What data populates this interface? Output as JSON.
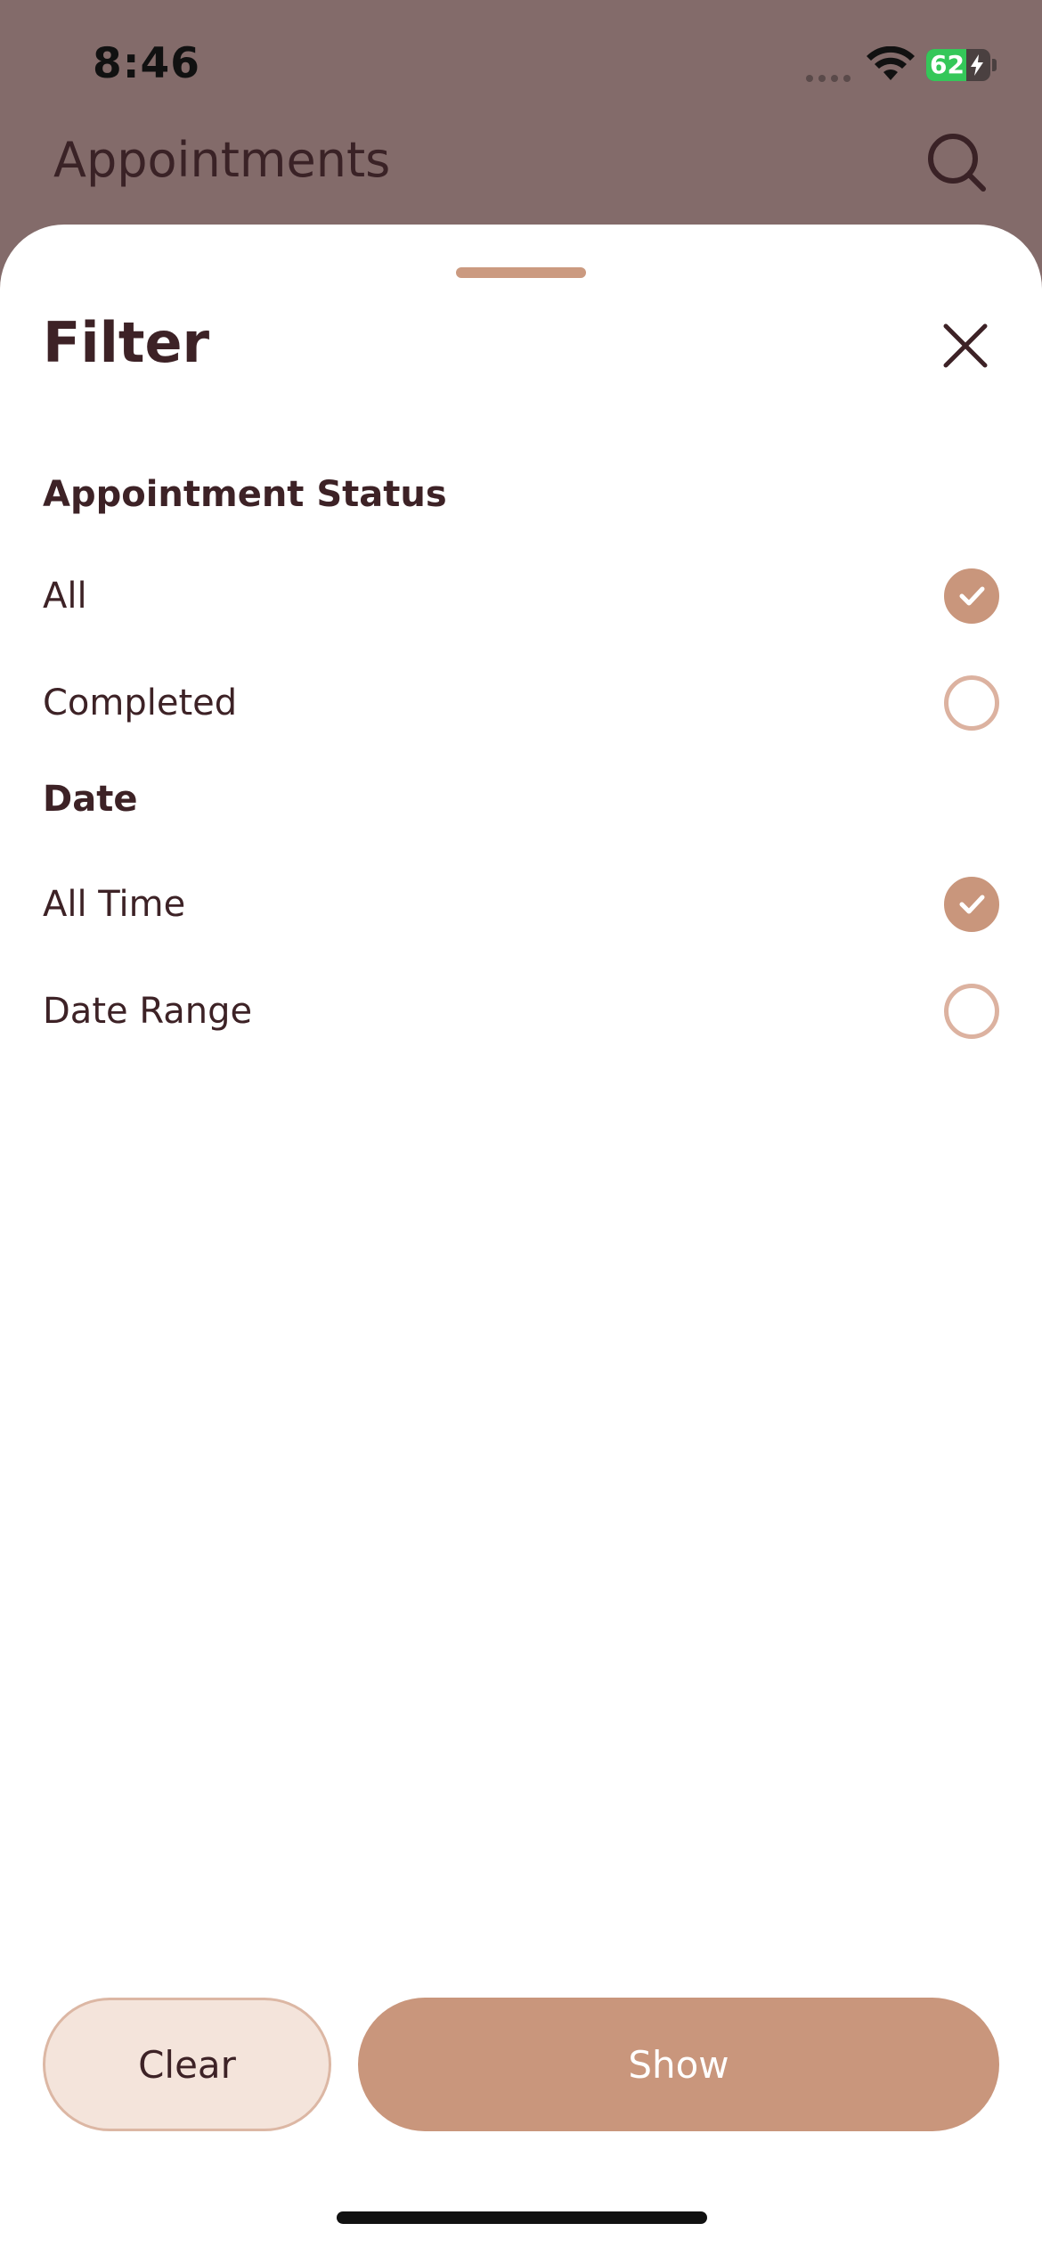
{
  "status_bar": {
    "time": "8:46",
    "battery_percent": "62",
    "battery_level": 0.62
  },
  "app_bar": {
    "title": "Appointments",
    "search_icon": "search-icon"
  },
  "filter_sheet": {
    "title": "Filter",
    "close_icon": "close-icon",
    "sections": [
      {
        "label": "Appointment Status",
        "options": [
          {
            "label": "All",
            "selected": true
          },
          {
            "label": "Completed",
            "selected": false
          }
        ]
      },
      {
        "label": "Date",
        "options": [
          {
            "label": "All Time",
            "selected": true
          },
          {
            "label": "Date Range",
            "selected": false
          }
        ]
      }
    ],
    "clear_label": "Clear",
    "show_label": "Show"
  },
  "colors": {
    "accent": "#c9967c",
    "accent_light": "#f4e4db",
    "text_dark": "#3d2226",
    "backdrop": "#836b6a"
  }
}
